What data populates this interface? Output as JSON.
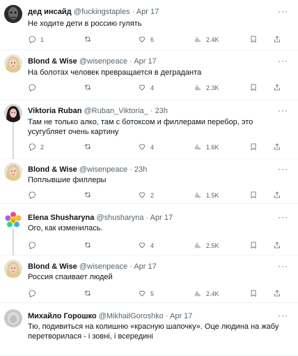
{
  "tweets": [
    {
      "name": "дед инсайд",
      "handle": "@fuckingstaples",
      "time": "Apr 17",
      "text": "Не ходите дети в россию гулять",
      "replies": "1",
      "retweets": "",
      "likes": "6",
      "views": "2.4K",
      "avatar": "dark"
    },
    {
      "name": "Blond & Wise",
      "handle": "@wisenpeace",
      "time": "Apr 17",
      "text": "На болотах человек превращается в деградантa",
      "replies": "",
      "retweets": "",
      "likes": "4",
      "views": "2.3K",
      "avatar": "blond"
    },
    {
      "name": "Viktoria Ruban",
      "handle": "@Ruban_Viktoria_",
      "time": "23h",
      "text": "Там не только алко, там с ботоксом и филлерами перебор, это усугубляет очень картину",
      "replies": "2",
      "retweets": "",
      "likes": "4",
      "views": "1.6K",
      "avatar": "darkhair"
    },
    {
      "name": "Blond & Wise",
      "handle": "@wisenpeace",
      "time": "23h",
      "text": "Поплывшие филлеры",
      "replies": "",
      "retweets": "",
      "likes": "2",
      "views": "1.5K",
      "avatar": "blond"
    },
    {
      "name": "Elena Shusharyna",
      "handle": "@shusharyna",
      "time": "Apr 17",
      "text": "Ого, как изменилась.",
      "replies": "",
      "retweets": "",
      "likes": "4",
      "views": "2.5K",
      "avatar": "flower"
    },
    {
      "name": "Blond & Wise",
      "handle": "@wisenpeace",
      "time": "Apr 17",
      "text": "Россия спаивает людей",
      "replies": "",
      "retweets": "",
      "likes": "5",
      "views": "2.4K",
      "avatar": "blond"
    },
    {
      "name": "Михайло Горошко",
      "handle": "@MikhailGoroshko",
      "time": "Apr 17",
      "text": "Тю, подивиться на колишню «красную шапочку». Оце людина на жабу перетворилася - і зовні, і всередині",
      "replies": "",
      "retweets": "",
      "likes": "",
      "views": "",
      "avatar": "grey"
    }
  ],
  "ui": {
    "separator": "·",
    "more": "···"
  },
  "icons": {
    "reply": "reply-icon",
    "retweet": "retweet-icon",
    "like": "heart-icon",
    "views": "views-icon",
    "bookmark": "bookmark-icon",
    "share": "share-icon"
  },
  "colors": {
    "text": "#0f1419",
    "muted": "#536471",
    "divider": "#eff3f4"
  }
}
